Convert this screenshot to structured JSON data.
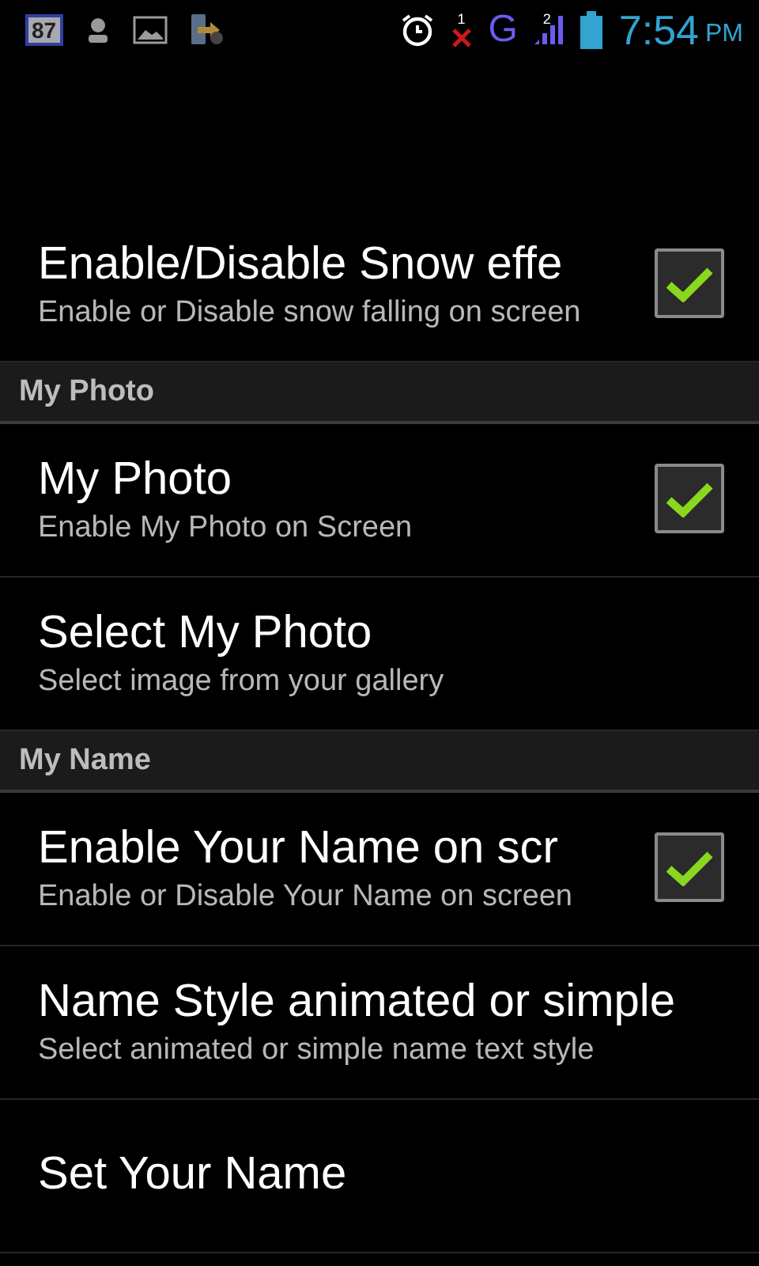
{
  "status_bar": {
    "battery_badge": "87",
    "missed_count": "1",
    "network": "G",
    "signal_sim": "2",
    "time": "7:54",
    "ampm": "PM"
  },
  "items": [
    {
      "kind": "checkbox",
      "title": "Enable/Disable Snow effe",
      "summary": "Enable or Disable snow falling on screen",
      "checked": true
    },
    {
      "kind": "header",
      "title": "My Photo"
    },
    {
      "kind": "checkbox",
      "title": "My Photo",
      "summary": "Enable My Photo on Screen",
      "checked": true
    },
    {
      "kind": "plain",
      "title": "Select My Photo",
      "summary": "Select image from your gallery"
    },
    {
      "kind": "header",
      "title": "My Name"
    },
    {
      "kind": "checkbox",
      "title": "Enable Your Name on scr",
      "summary": "Enable or Disable Your Name on screen",
      "checked": true
    },
    {
      "kind": "plain",
      "title": "Name Style animated or simple",
      "summary": "Select animated or simple name text style"
    },
    {
      "kind": "plain",
      "title": "Set Your Name"
    }
  ]
}
